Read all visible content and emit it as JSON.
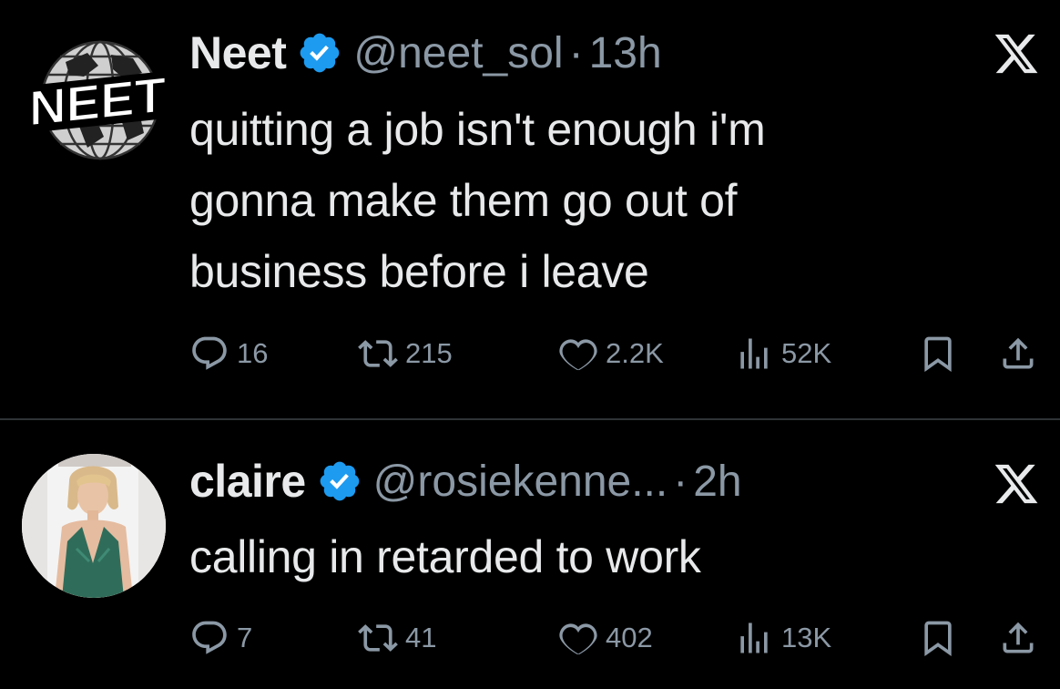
{
  "tweets": [
    {
      "name": "Neet",
      "handle": "@neet_sol",
      "separator": "·",
      "time": "13h",
      "avatar_label": "NEET",
      "text_lines": [
        "quitting a job isn't enough i'm",
        "gonna make them go out of",
        "business before i leave"
      ],
      "stats": {
        "replies": "16",
        "retweets": "215",
        "likes": "2.2K",
        "views": "52K"
      }
    },
    {
      "name": "claire",
      "handle": "@rosiekenne...",
      "separator": "·",
      "time": "2h",
      "text_lines": [
        "calling in retarded to work"
      ],
      "stats": {
        "replies": "7",
        "retweets": "41",
        "likes": "402",
        "views": "13K"
      }
    }
  ],
  "colors": {
    "background": "#000000",
    "text": "#e7e9ea",
    "muted": "#8b98a5",
    "verified": "#1d9bf0",
    "divider": "#2f3336"
  },
  "icons": [
    "verified-badge-icon",
    "x-logo-icon",
    "reply-icon",
    "retweet-icon",
    "like-icon",
    "views-icon",
    "bookmark-icon",
    "share-icon"
  ]
}
